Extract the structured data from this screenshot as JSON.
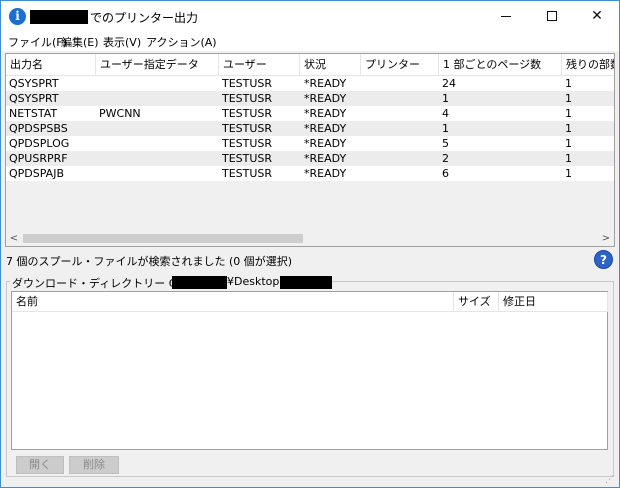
{
  "window": {
    "title_suffix": "でのプリンター出力",
    "app_icon_glyph": "i"
  },
  "menu": [
    {
      "label": "ファイル(F)"
    },
    {
      "label": "編集(E)"
    },
    {
      "label": "表示(V)"
    },
    {
      "label": "アクション(A)"
    }
  ],
  "table": {
    "columns": [
      "出力名",
      "ユーザー指定データ",
      "ユーザー",
      "状況",
      "プリンター",
      "1 部ごとのページ数",
      "残りの部数"
    ],
    "rows": [
      [
        "QSYSPRT",
        "",
        "TESTUSR",
        "*READY",
        "",
        "24",
        "1"
      ],
      [
        "QSYSPRT",
        "",
        "TESTUSR",
        "*READY",
        "",
        "1",
        "1"
      ],
      [
        "NETSTAT",
        "PWCNN",
        "TESTUSR",
        "*READY",
        "",
        "4",
        "1"
      ],
      [
        "QPDSPSBS",
        "",
        "TESTUSR",
        "*READY",
        "",
        "1",
        "1"
      ],
      [
        "QPDSPLOG",
        "",
        "TESTUSR",
        "*READY",
        "",
        "5",
        "1"
      ],
      [
        "QPUSRPRF",
        "",
        "TESTUSR",
        "*READY",
        "",
        "2",
        "1"
      ],
      [
        "QPDSPAJB",
        "",
        "TESTUSR",
        "*READY",
        "",
        "6",
        "1"
      ]
    ]
  },
  "status": {
    "text": "7 個のスプール・ファイルが検索されました (0 個が選択)"
  },
  "download": {
    "label_prefix": "ダウンロード・ディレクトリー C:¥Users¥",
    "label_middle": "¥Desktop¥",
    "columns": {
      "name": "名前",
      "size": "サイズ",
      "modified": "修正日"
    },
    "buttons": {
      "open": "開く",
      "delete": "削除"
    }
  },
  "colors": {
    "border_accent": "#3d8fd1",
    "app_icon": "#1c6fd1",
    "help_icon": "#2b64c8",
    "row_alt": "#ececec"
  }
}
